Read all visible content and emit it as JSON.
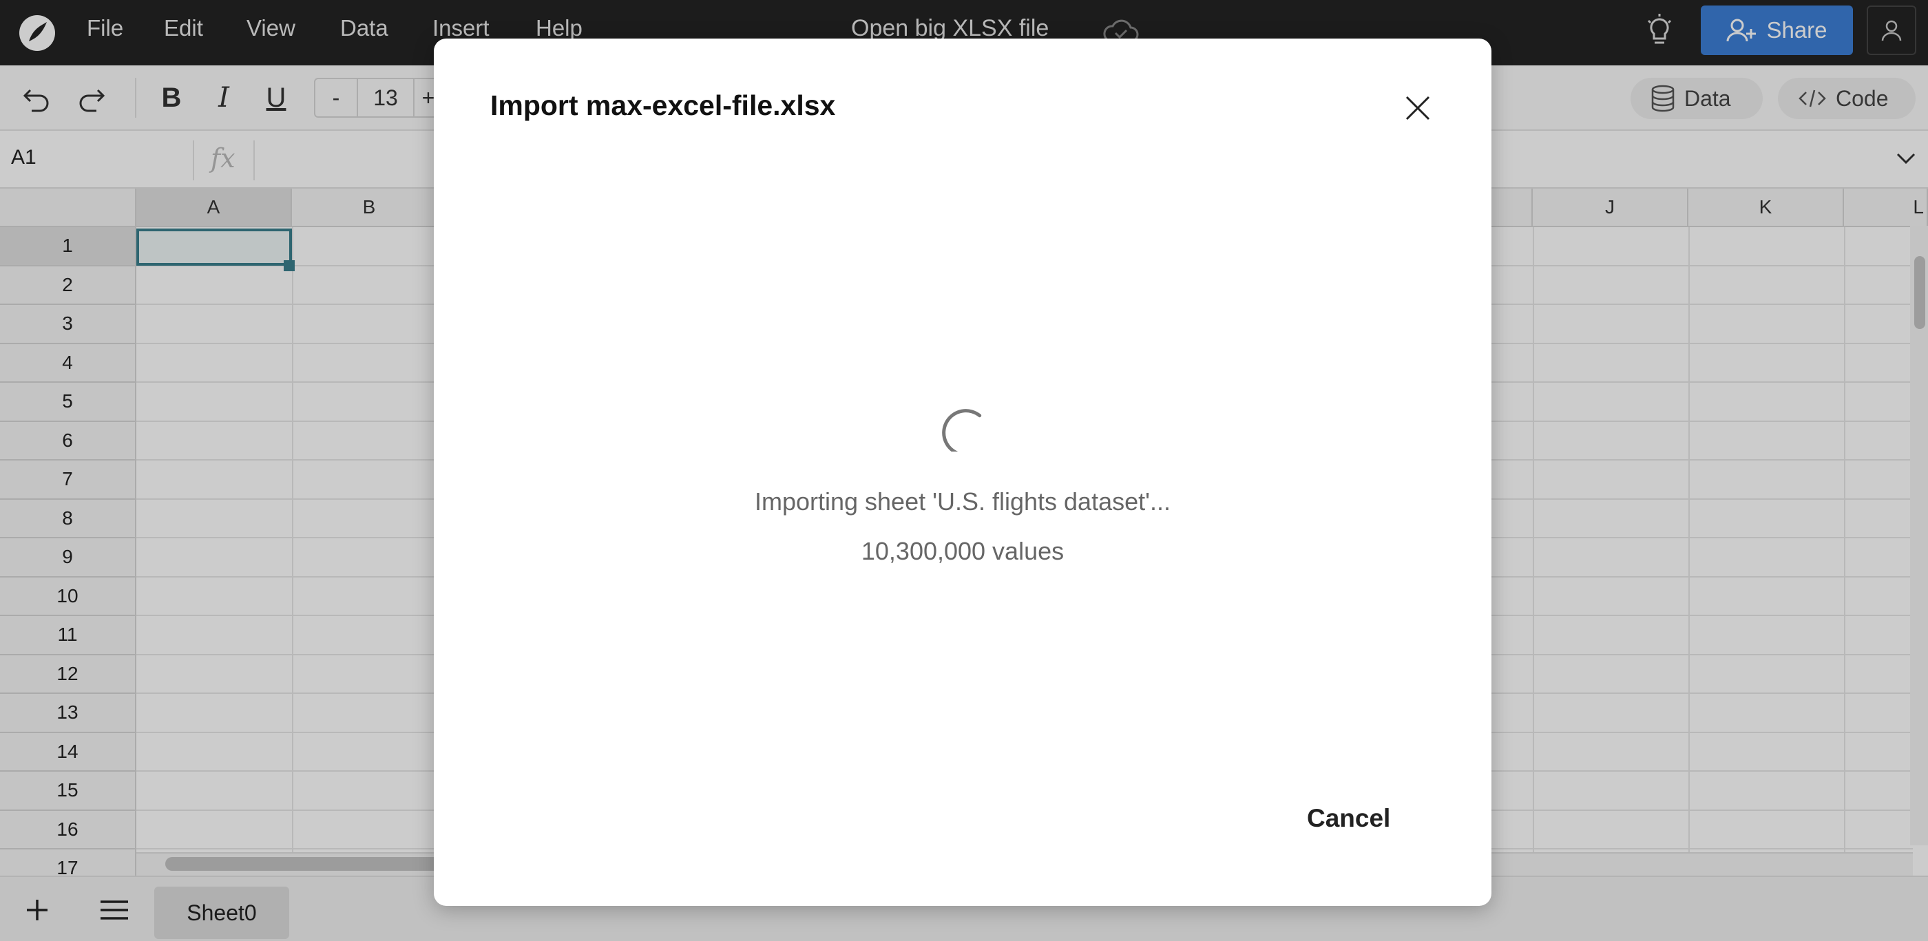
{
  "menu": {
    "items": [
      "File",
      "Edit",
      "View",
      "Data",
      "Insert",
      "Help"
    ]
  },
  "document": {
    "title": "Open big XLSX file"
  },
  "header": {
    "share_label": "Share"
  },
  "toolbar": {
    "bold_label": "B",
    "italic_label": "I",
    "underline_label": "U",
    "font_size_decrease": "-",
    "font_size": "13",
    "font_size_increase": "+",
    "data_label": "Data",
    "code_label": "Code"
  },
  "formula_bar": {
    "cell_ref": "A1",
    "fx_label": "fx"
  },
  "grid": {
    "visible_columns": [
      "A",
      "B",
      "J",
      "K",
      "L"
    ],
    "rows": [
      "1",
      "2",
      "3",
      "4",
      "5",
      "6",
      "7",
      "8",
      "9",
      "10",
      "11",
      "12",
      "13",
      "14",
      "15",
      "16",
      "17"
    ],
    "selected_cell": "A1"
  },
  "sheets": {
    "tabs": [
      "Sheet0"
    ]
  },
  "modal": {
    "title": "Import max-excel-file.xlsx",
    "status": "Importing sheet 'U.S. flights dataset'...",
    "count": "10,300,000 values",
    "cancel_label": "Cancel"
  },
  "colors": {
    "topbar": "#232323",
    "share_button": "#3d7fd6",
    "selection": "#3a7f8c"
  }
}
